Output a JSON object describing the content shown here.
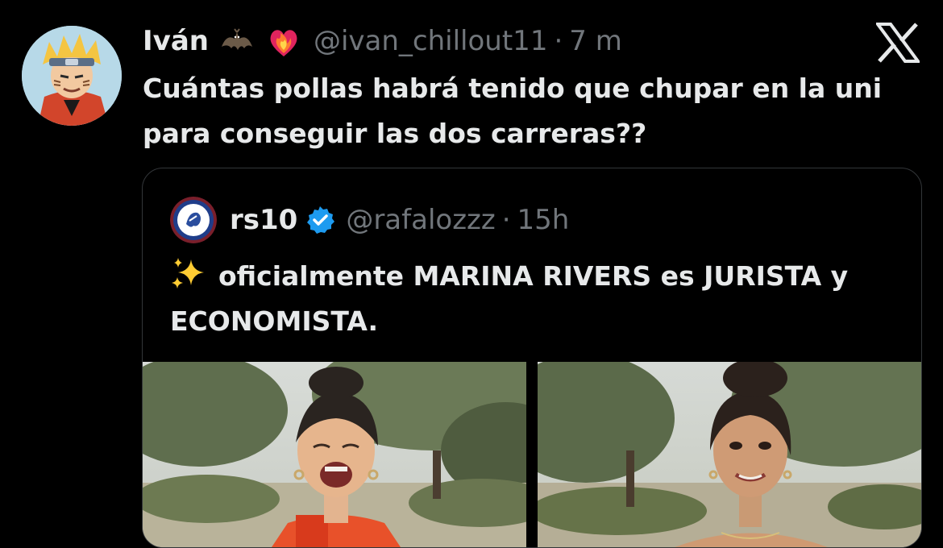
{
  "tweet": {
    "name": "Iván",
    "handle": "@ivan_chillout11",
    "separator": "·",
    "time": "7 m",
    "text": "Cuántas pollas habrá tenido que chupar en la uni para conseguir las dos carreras??",
    "emojis": [
      "bat-emoji",
      "heart-on-fire-emoji"
    ],
    "avatar": "naruto-avatar"
  },
  "quoted_tweet": {
    "name": "rs10",
    "verified": true,
    "handle": "@rafalozzz",
    "separator": "·",
    "time": "15h",
    "emoji": "sparkles-emoji",
    "text": "oficialmente MARINA RIVERS es JURISTA y ECONOMISTA.",
    "photos": [
      "woman-laughing-photo",
      "woman-smiling-photo"
    ]
  },
  "colors": {
    "background": "#000000",
    "text": "#e7e9ea",
    "muted": "#71767b",
    "border": "#333639",
    "verified": "#1d9bf0"
  }
}
